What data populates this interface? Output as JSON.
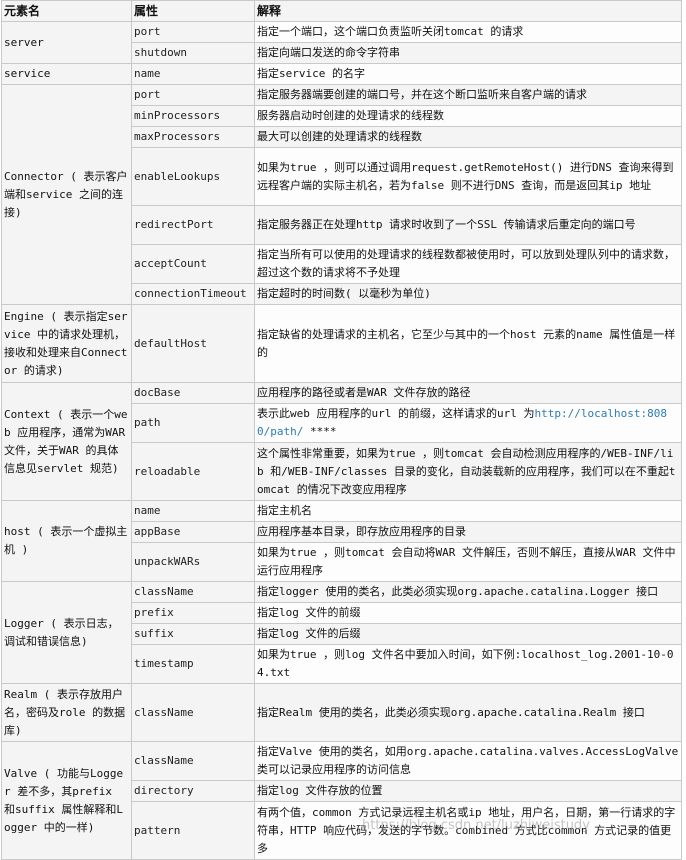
{
  "headers": {
    "element": "元素名",
    "attribute": "属性",
    "description": "解释"
  },
  "groups": [
    {
      "element": "server",
      "rows": [
        {
          "attr": "port",
          "desc": "指定一个端口，这个端口负责监听关闭tomcat 的请求"
        },
        {
          "attr": "shutdown",
          "desc": "指定向端口发送的命令字符串"
        }
      ]
    },
    {
      "element": "service",
      "rows": [
        {
          "attr": "name",
          "desc": "指定service 的名字"
        }
      ]
    },
    {
      "element": "Connector ( 表示客户端和service 之间的连接)",
      "rows": [
        {
          "attr": "port",
          "desc": "指定服务器端要创建的端口号，并在这个断口监听来自客户端的请求"
        },
        {
          "attr": "minProcessors",
          "desc": "服务器启动时创建的处理请求的线程数"
        },
        {
          "attr": "maxProcessors",
          "desc": "最大可以创建的处理请求的线程数"
        },
        {
          "attr": "enableLookups",
          "desc": "如果为true ，则可以通过调用request.getRemoteHost() 进行DNS 查询来得到远程客户端的实际主机名，若为false 则不进行DNS 查询，而是返回其ip 地址"
        },
        {
          "attr": "redirectPort",
          "desc": "指定服务器正在处理http 请求时收到了一个SSL 传输请求后重定向的端口号"
        },
        {
          "attr": "acceptCount",
          "desc": "指定当所有可以使用的处理请求的线程数都被使用时，可以放到处理队列中的请求数，超过这个数的请求将不予处理"
        },
        {
          "attr": "connectionTimeout",
          "desc": "指定超时的时间数( 以毫秒为单位)"
        }
      ]
    },
    {
      "element": "Engine ( 表示指定service 中的请求处理机，接收和处理来自Connector 的请求)",
      "rows": [
        {
          "attr": "defaultHost",
          "desc": "指定缺省的处理请求的主机名，它至少与其中的一个host 元素的name 属性值是一样的"
        }
      ]
    },
    {
      "element": "Context ( 表示一个web 应用程序，通常为WAR 文件，关于WAR 的具体信息见servlet 规范)",
      "rows": [
        {
          "attr": "docBase",
          "desc": "应用程序的路径或者是WAR 文件存放的路径"
        },
        {
          "attr": "path",
          "desc": "表示此web 应用程序的url 的前缀，这样请求的url 为",
          "url": "http://localhost:8080/path/",
          "desc_after": " ****"
        },
        {
          "attr": "reloadable",
          "desc": "这个属性非常重要，如果为true ，则tomcat 会自动检测应用程序的/WEB-INF/lib 和/WEB-INF/classes 目录的变化，自动装载新的应用程序，我们可以在不重起tomcat 的情况下改变应用程序"
        }
      ]
    },
    {
      "element": "host ( 表示一个虚拟主机 )",
      "rows": [
        {
          "attr": "name",
          "desc": "指定主机名"
        },
        {
          "attr": "appBase",
          "desc": "应用程序基本目录，即存放应用程序的目录"
        },
        {
          "attr": "unpackWARs",
          "desc": "如果为true ，则tomcat 会自动将WAR 文件解压，否则不解压，直接从WAR 文件中运行应用程序"
        }
      ]
    },
    {
      "element": "Logger ( 表示日志，调试和错误信息)",
      "rows": [
        {
          "attr": "className",
          "desc": "指定logger 使用的类名，此类必须实现org.apache.catalina.Logger 接口"
        },
        {
          "attr": "prefix",
          "desc": "指定log 文件的前缀"
        },
        {
          "attr": "suffix",
          "desc": "指定log 文件的后缀"
        },
        {
          "attr": "timestamp",
          "desc": "如果为true ，则log 文件名中要加入时间，如下例:localhost_log.2001-10-04.txt"
        }
      ]
    },
    {
      "element": "Realm ( 表示存放用户名，密码及role 的数据库)",
      "rows": [
        {
          "attr": "className",
          "desc": "指定Realm 使用的类名，此类必须实现org.apache.catalina.Realm 接口"
        }
      ]
    },
    {
      "element": "Valve ( 功能与Logger 差不多，其prefix 和suffix 属性解释和Logger 中的一样)",
      "rows": [
        {
          "attr": "className",
          "desc": "指定Valve 使用的类名，如用org.apache.catalina.valves.AccessLogValve 类可以记录应用程序的访问信息"
        },
        {
          "attr": "directory",
          "desc": "指定log 文件存放的位置"
        },
        {
          "attr": "pattern",
          "desc": "有两个值，common 方式记录远程主机名或ip 地址，用户名，日期，第一行请求的字符串，HTTP 响应代码，发送的字节数。combined 方式比common 方式记录的值更多"
        }
      ]
    }
  ],
  "watermark": "https://blog.csdn.net/luzhiweistudy"
}
